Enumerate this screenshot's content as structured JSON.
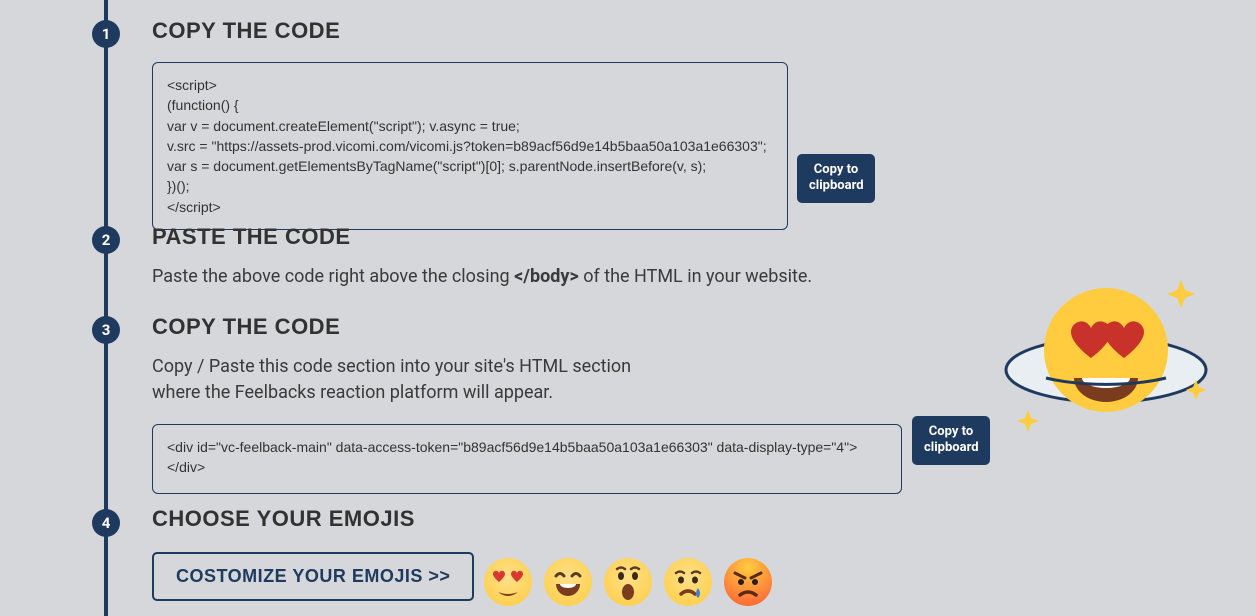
{
  "steps": {
    "s1": {
      "num": "1",
      "title": "COPY THE CODE"
    },
    "s2": {
      "num": "2",
      "title": "PASTE THE CODE",
      "desc_pre": "Paste the above code right above the closing ",
      "desc_bold": "</body>",
      "desc_post": " of the HTML in your website."
    },
    "s3": {
      "num": "3",
      "title": "COPY THE CODE",
      "desc": "Copy / Paste this code section into your site's HTML section\nwhere the Feelbacks reaction platform will appear."
    },
    "s4": {
      "num": "4",
      "title": "CHOOSE YOUR EMOJIS"
    }
  },
  "code1": "<script>\n(function() {\nvar v = document.createElement(\"script\"); v.async = true;\nv.src = \"https://assets-prod.vicomi.com/vicomi.js?token=b89acf56d9e14b5baa50a103a1e66303\";\nvar s = document.getElementsByTagName(\"script\")[0]; s.parentNode.insertBefore(v, s);\n})();\n</script>",
  "code2": "<div id=\"vc-feelback-main\" data-access-token=\"b89acf56d9e14b5baa50a103a1e66303\" data-display-type=\"4\"></div>",
  "buttons": {
    "copy": "Copy to\nclipboard",
    "customize": "COSTOMIZE YOUR EMOJIS >>"
  },
  "emojis": [
    "heart-eyes",
    "laugh",
    "wow",
    "sad",
    "angry"
  ]
}
